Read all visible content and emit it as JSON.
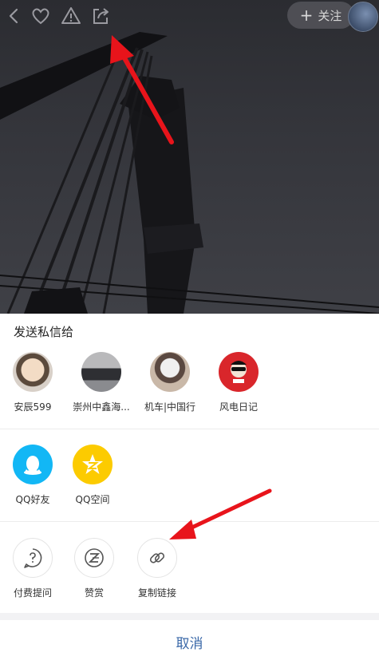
{
  "header": {
    "icons": [
      "back-icon",
      "heart-icon",
      "warning-icon",
      "share-icon"
    ],
    "follow_plus": "+",
    "follow_label": "关注"
  },
  "share_sheet": {
    "title": "发送私信给",
    "contacts": [
      {
        "name": "安辰599"
      },
      {
        "name": "崇州中鑫海..."
      },
      {
        "name": "机车|中国行"
      },
      {
        "name": "风电日记"
      }
    ],
    "apps": [
      {
        "label": "QQ好友",
        "icon": "qq-icon",
        "color": "#12b7f5"
      },
      {
        "label": "QQ空间",
        "icon": "qzone-icon",
        "color": "#fccb00"
      }
    ],
    "tools": [
      {
        "label": "付费提问",
        "icon": "paid-question-icon"
      },
      {
        "label": "赞赏",
        "icon": "reward-icon"
      },
      {
        "label": "复制链接",
        "icon": "link-icon"
      }
    ],
    "cancel_label": "取消"
  },
  "colors": {
    "accent_blue": "#3a68a8",
    "annotation_arrow": "#e8141b"
  }
}
